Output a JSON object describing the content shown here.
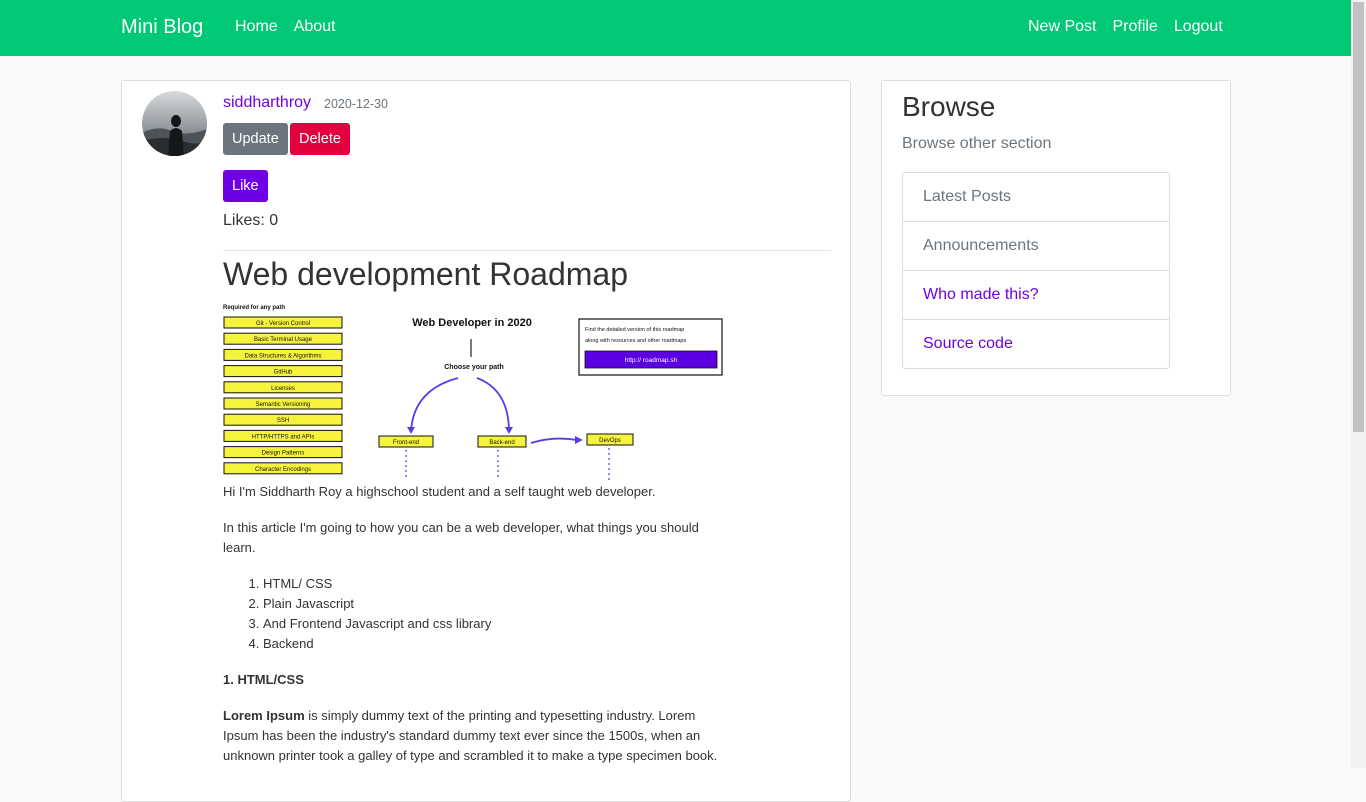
{
  "nav": {
    "brand": "Mini Blog",
    "left_links": [
      "Home",
      "About"
    ],
    "right_links": [
      "New Post",
      "Profile",
      "Logout"
    ]
  },
  "post": {
    "author": "siddharthroy",
    "date": "2020-12-30",
    "update_label": "Update",
    "delete_label": "Delete",
    "like_label": "Like",
    "likes_text": "Likes: 0",
    "title": "Web development Roadmap",
    "roadmap_image": {
      "small_heading": "Required for any path",
      "required_items": [
        "Git - Version Control",
        "Basic Terminal Usage",
        "Data Structures & Algorithms",
        "GitHub",
        "Licenses",
        "Semantic Versioning",
        "SSH",
        "HTTP/HTTPS and APIs",
        "Design Patterns",
        "Character Encodings"
      ],
      "heading": "Web Developer in 2020",
      "choose": "Choose your path",
      "paths": [
        "Front-end",
        "Back-end",
        "DevOps"
      ],
      "promo_line1": "Find the detailed version of this roadmap",
      "promo_line2": "along with resources and other roadmaps",
      "promo_link": "http:// roadmap.sh"
    },
    "intro": "Hi I'm Siddharth Roy a highschool student and a self taught web developer.",
    "article_intro": "In this article I'm going to how you can be a web developer, what things you should learn.",
    "list": [
      "HTML/ CSS",
      "Plain Javascript",
      "And Frontend Javascript and css library",
      "Backend"
    ],
    "section_heading": "1. HTML/CSS",
    "lorem_bold": "Lorem Ipsum",
    "lorem_rest": " is simply dummy text of the printing and typesetting industry. Lorem Ipsum has been the industry's standard dummy text ever since the 1500s, when an unknown printer took a galley of type and scrambled it to make a type specimen book."
  },
  "sidebar": {
    "title": "Browse",
    "subtitle": "Browse other section",
    "items": [
      "Latest Posts",
      "Announcements",
      "Who made this?",
      "Source code"
    ]
  },
  "colors": {
    "navbar": "#00c875",
    "accent": "#6f00e5",
    "danger": "#e4003d",
    "secondary": "#6c757d"
  }
}
